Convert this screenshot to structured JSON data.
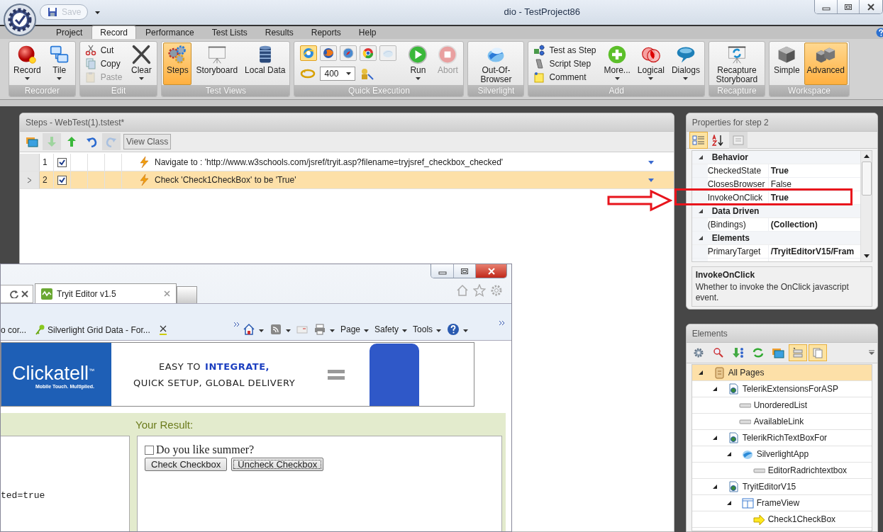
{
  "title_bar": {
    "save_label": "Save",
    "title": "dio - TestProject86"
  },
  "ribbon": {
    "tabs": [
      {
        "label": "Project",
        "selected": false
      },
      {
        "label": "Record",
        "selected": true
      },
      {
        "label": "Performance",
        "selected": false
      },
      {
        "label": "Test Lists",
        "selected": false
      },
      {
        "label": "Results",
        "selected": false
      },
      {
        "label": "Reports",
        "selected": false
      },
      {
        "label": "Help",
        "selected": false
      }
    ],
    "groups": [
      {
        "label": "Recorder",
        "items": [
          {
            "kind": "large",
            "label": "Record",
            "dropdown": true
          },
          {
            "kind": "large",
            "label": "Tile",
            "dropdown": true
          }
        ]
      },
      {
        "label": "Edit",
        "items": [
          {
            "kind": "stack",
            "entries": [
              {
                "label": "Cut",
                "disabled": false
              },
              {
                "label": "Copy",
                "disabled": false
              },
              {
                "label": "Paste",
                "disabled": true
              }
            ]
          },
          {
            "kind": "large",
            "label": "Clear",
            "dropdown": true
          }
        ]
      },
      {
        "label": "Test Views",
        "items": [
          {
            "kind": "large",
            "label": "Steps",
            "selected": true
          },
          {
            "kind": "large",
            "label": "Storyboard",
            "selected": false
          },
          {
            "kind": "large",
            "label": "Local Data",
            "selected": false
          }
        ]
      },
      {
        "label": "Quick Execution",
        "items": [
          {
            "kind": "browsers",
            "browsers": [
              {
                "selected": true,
                "disabled": false
              },
              {
                "selected": false,
                "disabled": false
              },
              {
                "selected": false,
                "disabled": false
              },
              {
                "selected": false,
                "disabled": false
              },
              {
                "selected": false,
                "disabled": true
              }
            ],
            "speed": "400"
          },
          {
            "kind": "large",
            "label": "Run",
            "dropdown": true,
            "disabled": false
          },
          {
            "kind": "large",
            "label": "Abort",
            "disabled": true
          }
        ]
      },
      {
        "label": "Silverlight",
        "items": [
          {
            "kind": "large",
            "label": "Out-Of-Browser"
          }
        ]
      },
      {
        "label": "Add",
        "items": [
          {
            "kind": "stack",
            "entries": [
              {
                "label": "Test as Step",
                "disabled": false
              },
              {
                "label": "Script Step",
                "disabled": false
              },
              {
                "label": "Comment",
                "disabled": false
              }
            ]
          },
          {
            "kind": "large",
            "label": "More...",
            "dropdown": true
          },
          {
            "kind": "large",
            "label": "Logical",
            "dropdown": true
          },
          {
            "kind": "large",
            "label": "Dialogs",
            "dropdown": true
          }
        ]
      },
      {
        "label": "Recapture",
        "items": [
          {
            "kind": "large",
            "label": "Recapture Storyboard"
          }
        ]
      },
      {
        "label": "Workspace",
        "items": [
          {
            "kind": "large",
            "label": "Simple",
            "selected": false
          },
          {
            "kind": "large",
            "label": "Advanced",
            "selected": true
          }
        ]
      }
    ]
  },
  "steps_panel": {
    "title": "Steps - WebTest(1).tstest*",
    "view_class_label": "View Class",
    "rows": [
      {
        "number": "1",
        "checked": true,
        "description": "Navigate to : 'http://www.w3schools.com/jsref/tryit.asp?filename=tryjsref_checkbox_checked'",
        "selected": false
      },
      {
        "number": "2",
        "checked": true,
        "description": "Check 'Check1CheckBox' to be 'True'",
        "selected": true
      }
    ]
  },
  "properties_panel": {
    "title": "Properties for step 2",
    "categories": [
      {
        "name": "Behavior",
        "expanded": true,
        "properties": [
          {
            "name": "CheckedState",
            "value": "True",
            "modified": true
          },
          {
            "name": "ClosesBrowser",
            "value": "False",
            "modified": false
          },
          {
            "name": "InvokeOnClick",
            "value": "True",
            "modified": true
          }
        ]
      },
      {
        "name": "Data Driven",
        "expanded": true,
        "properties": [
          {
            "name": "(Bindings)",
            "value": "(Collection)",
            "modified": true
          }
        ]
      },
      {
        "name": "Elements",
        "expanded": true,
        "properties": [
          {
            "name": "PrimaryTarget",
            "value": "/TryitEditorV15/Fram",
            "modified": true
          }
        ]
      }
    ],
    "description_title": "InvokeOnClick",
    "description": "Whether to invoke the OnClick javascript event."
  },
  "elements_panel": {
    "title": "Elements",
    "tree": [
      {
        "label": "All Pages",
        "kind": "root",
        "expanded": true,
        "selected": true,
        "children": [
          {
            "label": "TelerikExtensionsForASP",
            "kind": "page",
            "expanded": true,
            "selected": false,
            "children": [
              {
                "label": "UnorderedList",
                "kind": "element",
                "selected": false
              },
              {
                "label": "AvailableLink",
                "kind": "element",
                "selected": false
              }
            ]
          },
          {
            "label": "TelerikRichTextBoxFor",
            "kind": "page",
            "expanded": true,
            "selected": false,
            "children": [
              {
                "label": "SilverlightApp",
                "kind": "silverlight",
                "expanded": true,
                "selected": false,
                "children": [
                  {
                    "label": "EditorRadrichtextbox",
                    "kind": "element",
                    "selected": false
                  }
                ]
              }
            ]
          },
          {
            "label": "TryitEditorV15",
            "kind": "page",
            "expanded": true,
            "selected": false,
            "children": [
              {
                "label": "FrameView",
                "kind": "frame",
                "expanded": true,
                "selected": false,
                "children": [
                  {
                    "label": "Check1CheckBox",
                    "kind": "target",
                    "selected": false
                  }
                ]
              }
            ]
          }
        ]
      }
    ]
  },
  "browser_window": {
    "tabs": [
      {
        "title": "Tryit Editor v1.5",
        "selected": true
      }
    ],
    "favorites": [
      "o cor...",
      "Silverlight Grid Data - For..."
    ],
    "commands": [
      "Page",
      "Safety",
      "Tools"
    ],
    "ad": {
      "brand": "Clickatell$^{™}$",
      "tagline": "Mobile Touch. Multiplied.",
      "line1": "EASY TO",
      "line1_highlight": "INTEGRATE,",
      "line2": "QUICK SETUP, GLOBAL DELIVERY"
    },
    "result_heading": "Your Result:",
    "code_fragment": "ted=true",
    "checkbox": {
      "label": "Do you like summer?",
      "checked": false
    },
    "buttons": [
      "Check Checkbox",
      "Uncheck Checkbox"
    ]
  }
}
